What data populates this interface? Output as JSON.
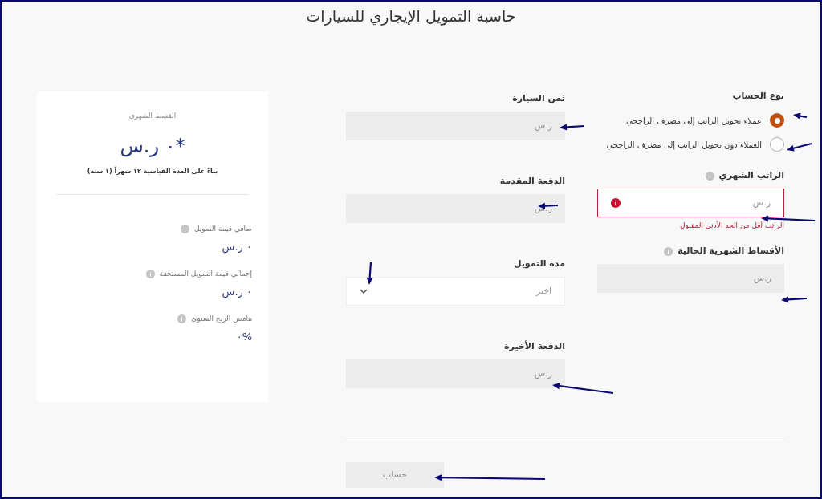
{
  "title": "حاسبة التمويل الإيجاري للسيارات",
  "account_type": {
    "label": "نوع الحساب",
    "options": [
      {
        "label": "عملاء تحويل الراتب إلى مصرف الراجحي",
        "selected": true
      },
      {
        "label": "العملاء دون تحويل الراتب إلى مصرف الراجحي",
        "selected": false
      }
    ]
  },
  "right_fields": [
    {
      "label": "الراتب الشهري",
      "info": true,
      "kind": "input",
      "placeholder": "ر.س",
      "disabled": false,
      "invalid": true,
      "error": "الراتب أقل من الحد الأدنى المقبول"
    },
    {
      "label": "الأقساط الشهرية الحالية",
      "info": true,
      "kind": "input",
      "placeholder": "ر.س",
      "disabled": true
    }
  ],
  "middle_fields": [
    {
      "label": "ثمن السيارة",
      "kind": "input",
      "placeholder": "ر.س",
      "disabled": true
    },
    {
      "label": "الدفعة المقدمة",
      "kind": "input",
      "placeholder": "ر.س",
      "disabled": true
    },
    {
      "label": "مدة التمويل",
      "kind": "select",
      "placeholder": "اختر"
    },
    {
      "label": "الدفعة الأخيرة",
      "kind": "input",
      "placeholder": "ر.س",
      "disabled": true
    }
  ],
  "button": {
    "label": "حساب",
    "disabled": true
  },
  "summary": {
    "label": "القسط الشهري",
    "value": "*٠ ر.س",
    "note": "بناءً على المدة القياسية ١٢ شهراً (١ سنه)",
    "items": [
      {
        "label": "صافي قيمة التمويل",
        "info": true,
        "value": "٠ ر.س"
      },
      {
        "label": "إجمالي قيمة التمويل المستحقة",
        "info": true,
        "value": "٠ ر.س"
      },
      {
        "label": "هامش الربح السنوي",
        "info": true,
        "value": "%٠"
      }
    ]
  }
}
